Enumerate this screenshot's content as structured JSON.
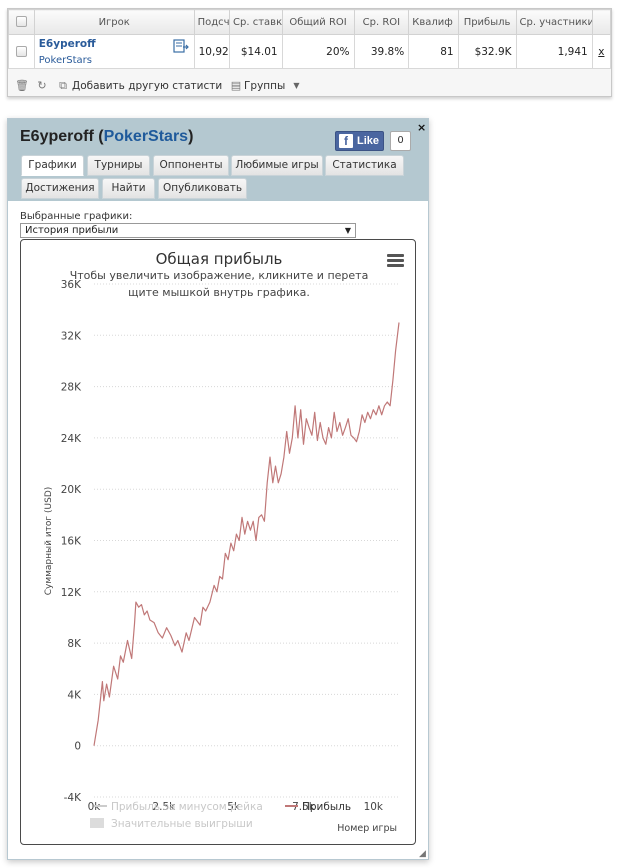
{
  "table": {
    "headers": [
      "Игрок",
      "Подсч",
      "Ср. ставка",
      "Общий ROI",
      "Ср. ROI",
      "Квалиф",
      "Прибыль",
      "Ср. участники"
    ],
    "row": {
      "player": "Е6уperoff",
      "site": "PokerStars",
      "count": "10,92",
      "avg_stake": "$14.01",
      "total_roi": "20%",
      "avg_roi": "39.8%",
      "itm": "81",
      "profit": "$32.9K",
      "avg_field": "1,941",
      "remove": "x"
    }
  },
  "toolbar": {
    "add_stats": "Добавить другую статистику",
    "groups": "Группы"
  },
  "window": {
    "player": "Е6уperoff",
    "paren_open": " (",
    "site": "PokerStars",
    "paren_close": ")",
    "close": "×",
    "fb_like": "Like",
    "fb_count": "0",
    "tabs": [
      "Графики",
      "Турниры",
      "Оппоненты",
      "Любимые игры",
      "Статистика",
      "Достижения",
      "Найти",
      "Опубликовать"
    ],
    "selected_charts_label": "Выбранные графики:",
    "selected_chart": "История прибыли"
  },
  "colors": {
    "accent_link": "#2a5b9a",
    "header_bg": "#b4c8d0",
    "profit_line": "#c07878",
    "facebook": "#4a66a0"
  },
  "chart_data": {
    "type": "line",
    "title": "Общая прибыль",
    "subtitle": "Чтобы увеличить изображение, кликните и перетащите мышкой внутрь графика.",
    "ylabel": "Суммарный итог (USD)",
    "xlabel": "Номер игры",
    "xlim": [
      0,
      10920
    ],
    "ylim": [
      -4000,
      36000
    ],
    "y_ticks": [
      -4000,
      0,
      4000,
      8000,
      12000,
      16000,
      20000,
      24000,
      28000,
      32000,
      36000
    ],
    "y_tick_labels": [
      "-4K",
      "0",
      "4K",
      "8K",
      "12K",
      "16K",
      "20K",
      "24K",
      "28K",
      "32K",
      "36K"
    ],
    "x_ticks": [
      0,
      2500,
      5000,
      7500,
      10000
    ],
    "x_tick_labels": [
      "0k",
      "2.5k",
      "5k",
      "7.5k",
      "10k"
    ],
    "grid": true,
    "legend": [
      "Прибыль за минусом рейка",
      "Прибыль",
      "Значительные выигрыши"
    ],
    "series": [
      {
        "name": "Прибыль",
        "x": [
          0,
          150,
          300,
          350,
          450,
          550,
          700,
          850,
          950,
          1050,
          1200,
          1350,
          1450,
          1500,
          1600,
          1700,
          1800,
          1900,
          2000,
          2150,
          2300,
          2450,
          2600,
          2750,
          2900,
          3000,
          3150,
          3300,
          3400,
          3600,
          3800,
          3900,
          4000,
          4150,
          4300,
          4400,
          4500,
          4600,
          4700,
          4800,
          4900,
          5000,
          5100,
          5200,
          5300,
          5400,
          5500,
          5600,
          5700,
          5800,
          5900,
          6000,
          6100,
          6200,
          6300,
          6400,
          6500,
          6600,
          6700,
          6800,
          6900,
          7000,
          7100,
          7200,
          7300,
          7400,
          7500,
          7600,
          7700,
          7800,
          7900,
          8000,
          8100,
          8200,
          8300,
          8400,
          8500,
          8600,
          8700,
          8800,
          8900,
          9000,
          9100,
          9200,
          9300,
          9400,
          9500,
          9600,
          9700,
          9800,
          9900,
          10000,
          10100,
          10200,
          10300,
          10400,
          10500,
          10600,
          10700,
          10800,
          10920
        ],
        "values": [
          0,
          2000,
          5000,
          3500,
          4800,
          3800,
          6200,
          5200,
          7000,
          6500,
          8200,
          6800,
          9500,
          11200,
          10800,
          11000,
          10200,
          10500,
          9800,
          9600,
          8800,
          8400,
          9200,
          8600,
          7800,
          8200,
          7300,
          8800,
          8200,
          10000,
          9400,
          10800,
          10500,
          11200,
          12500,
          12000,
          13200,
          13000,
          15000,
          14500,
          15800,
          15200,
          16500,
          16000,
          17800,
          16500,
          17500,
          16800,
          17500,
          16000,
          17800,
          18000,
          17500,
          20500,
          22500,
          20500,
          21800,
          20500,
          21200,
          22500,
          24500,
          22800,
          24000,
          26500,
          24000,
          26200,
          23500,
          25500,
          24800,
          24200,
          26000,
          23800,
          25200,
          24000,
          23500,
          24800,
          24000,
          26000,
          24500,
          25200,
          24200,
          24800,
          25500,
          24200,
          24000,
          23700,
          24500,
          25800,
          25200,
          26000,
          25500,
          26200,
          25800,
          26500,
          25800,
          26500,
          26800,
          26500,
          28500,
          30800,
          33000
        ]
      }
    ]
  }
}
